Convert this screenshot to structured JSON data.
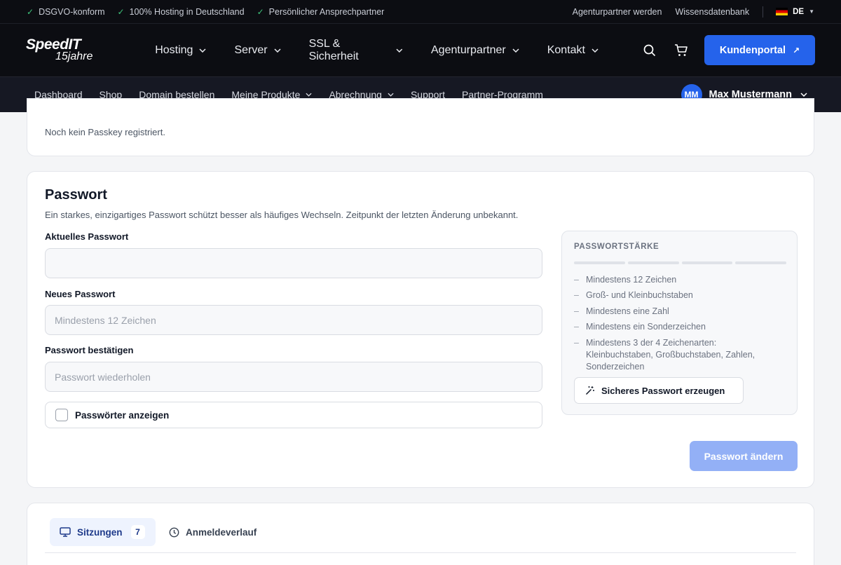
{
  "topbar": {
    "features": [
      "DSGVO-konform",
      "100% Hosting in Deutschland",
      "Persönlicher Ansprechpartner"
    ],
    "links": [
      "Agenturpartner werden",
      "Wissensdatenbank"
    ],
    "language": "DE"
  },
  "brand": {
    "name": "SpeedIT",
    "tagline": "15jahre"
  },
  "mainnav": {
    "items": [
      "Hosting",
      "Server",
      "SSL & Sicherheit",
      "Agenturpartner",
      "Kontakt"
    ],
    "portal_button": "Kundenportal"
  },
  "subnav": {
    "items": [
      "Dashboard",
      "Shop",
      "Domain bestellen",
      "Meine Produkte",
      "Abrechnung",
      "Support",
      "Partner-Programm"
    ],
    "user_initials": "MM",
    "user_name": "Max Mustermann"
  },
  "passkey": {
    "empty_text": "Noch kein Passkey registriert."
  },
  "password": {
    "title": "Passwort",
    "description": "Ein starkes, einzigartiges Passwort schützt besser als häufiges Wechseln. Zeitpunkt der letzten Änderung unbekannt.",
    "current_label": "Aktuelles Passwort",
    "current_value": "",
    "new_label": "Neues Passwort",
    "new_placeholder": "Mindestens 12 Zeichen",
    "confirm_label": "Passwort bestätigen",
    "confirm_placeholder": "Passwort wiederholen",
    "show_label": "Passwörter anzeigen",
    "strength": {
      "title": "PASSWORTSTÄRKE",
      "level": 0,
      "rules": [
        "Mindestens 12 Zeichen",
        "Groß- und Kleinbuchstaben",
        "Mindestens eine Zahl",
        "Mindestens ein Sonderzeichen",
        "Mindestens 3 der 4 Zeichenarten: Kleinbuchstaben, Großbuchstaben, Zahlen, Sonderzeichen"
      ],
      "generate_button": "Sicheres Passwort erzeugen"
    },
    "submit_button": "Passwort ändern"
  },
  "sessions": {
    "tabs": [
      {
        "label": "Sitzungen",
        "count": "7"
      },
      {
        "label": "Anmeldeverlauf"
      }
    ]
  },
  "colors": {
    "accent": "#2563eb",
    "dark": "#0c0d12",
    "disabled_button": "#93b0f6"
  }
}
